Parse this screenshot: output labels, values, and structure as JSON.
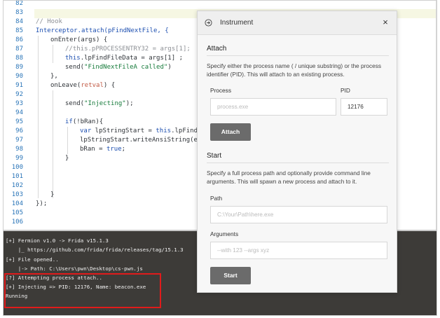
{
  "editor": {
    "line_numbers": [
      "82",
      "83",
      "84",
      "85",
      "86",
      "87",
      "88",
      "89",
      "90",
      "91",
      "92",
      "93",
      "94",
      "95",
      "96",
      "97",
      "98",
      "99",
      "100",
      "101",
      "102",
      "103",
      "104",
      "105",
      "106"
    ],
    "lines": {
      "l84": "// Hook",
      "l85": "Interceptor.attach(pFindNextFile, {",
      "l86": "onEnter(args) {",
      "l87": "//this.pPROCESSENTRY32 = args[1];",
      "l88a": "this",
      "l88b": ".lpFindFileData = args[1] ;",
      "l89a": "send(",
      "l89b": "\"FindNextFileA called\"",
      "l89c": ")",
      "l90": "},",
      "l91a": "onLeave(",
      "l91b": "retval",
      "l91c": ") {",
      "l93a": "send(",
      "l93b": "\"Injecting\"",
      "l93c": ");",
      "l95a": "if",
      "l95b": "(!bRan){",
      "l96a": "var",
      "l96b": " lpStringStart = ",
      "l96c": "this",
      "l96d": ".lpFindF",
      "l97": "lpStringStart.writeAnsiString(ex",
      "l98a": "bRan = ",
      "l98b": "true",
      "l98c": ";",
      "l99": "}",
      "l104": "}",
      "l105": "});"
    }
  },
  "console": {
    "lines": [
      "[+] Fermion v1.0 -> Frida v15.1.3",
      "    |_ https://github.com/frida/frida/releases/tag/15.1.3",
      "[+] File opened..",
      "    |-> Path: C:\\Users\\pwn\\Desktop\\cs-pwn.js",
      "[?] Attempting process attach..",
      "[+] Injecting => PID: 12176, Name: beacon.exe",
      "Running"
    ]
  },
  "instrument": {
    "title": "Instrument",
    "close_label": "×",
    "attach": {
      "heading": "Attach",
      "description": "Specify either the process name ( / unique substring) or the process identifier (PID). This will attach to an existing process.",
      "process_label": "Process",
      "process_placeholder": "process.exe",
      "pid_label": "PID",
      "pid_value": "12176",
      "button": "Attach"
    },
    "start": {
      "heading": "Start",
      "description": "Specify a full process path and optionally provide command line arguments. This will spawn a new process and attach to it.",
      "path_label": "Path",
      "path_placeholder": "C:\\Your\\Path\\here.exe",
      "args_label": "Arguments",
      "args_placeholder": "--with 123 --args xyz",
      "button": "Start"
    }
  },
  "colors": {
    "line_number": "#2a75b8",
    "console_bg": "#3d3b38",
    "highlight_box": "#e01b1b",
    "button": "#6b6b6b"
  }
}
